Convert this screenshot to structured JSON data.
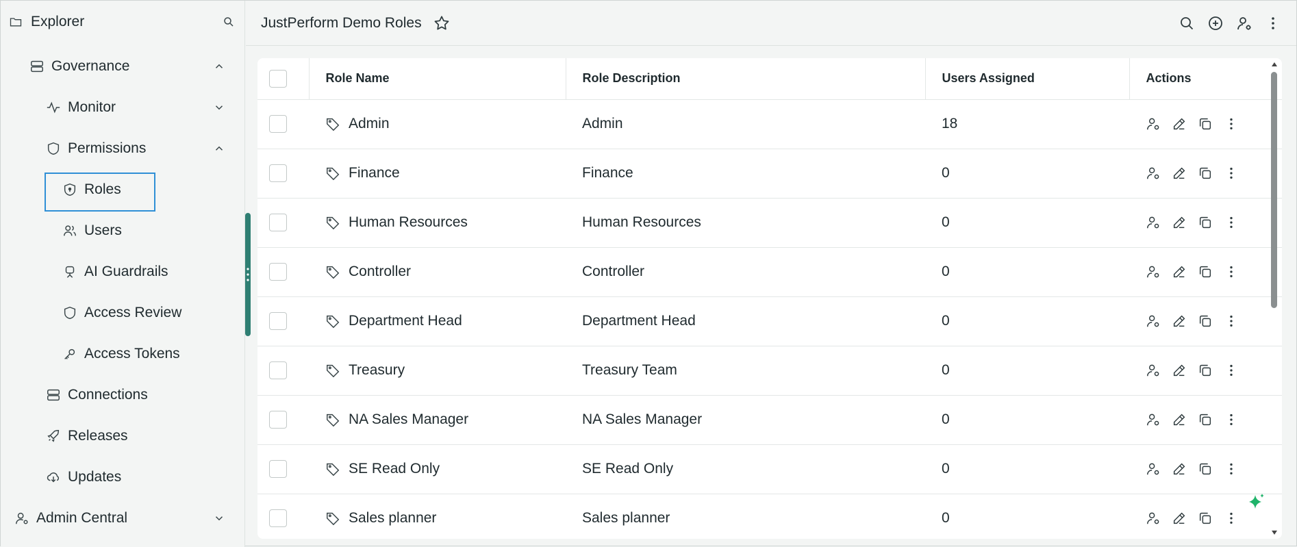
{
  "sidebar": {
    "title": "Explorer",
    "items": [
      {
        "label": "Governance"
      },
      {
        "label": "Monitor"
      },
      {
        "label": "Permissions"
      },
      {
        "label": "Roles"
      },
      {
        "label": "Users"
      },
      {
        "label": "AI Guardrails"
      },
      {
        "label": "Access Review"
      },
      {
        "label": "Access Tokens"
      },
      {
        "label": "Connections"
      },
      {
        "label": "Releases"
      },
      {
        "label": "Updates"
      },
      {
        "label": "Admin Central"
      }
    ]
  },
  "header": {
    "title": "JustPerform Demo Roles"
  },
  "table": {
    "columns": {
      "name": "Role Name",
      "description": "Role Description",
      "users": "Users Assigned",
      "actions": "Actions"
    },
    "rows": [
      {
        "name": "Admin",
        "description": "Admin",
        "users": "18"
      },
      {
        "name": "Finance",
        "description": "Finance",
        "users": "0"
      },
      {
        "name": "Human Resources",
        "description": "Human Resources",
        "users": "0"
      },
      {
        "name": "Controller",
        "description": "Controller",
        "users": "0"
      },
      {
        "name": "Department Head",
        "description": "Department Head",
        "users": "0"
      },
      {
        "name": "Treasury",
        "description": "Treasury Team",
        "users": "0"
      },
      {
        "name": "NA Sales Manager",
        "description": "NA Sales Manager",
        "users": "0"
      },
      {
        "name": "SE Read Only",
        "description": "SE Read Only",
        "users": "0"
      },
      {
        "name": "Sales planner",
        "description": "Sales planner",
        "users": "0"
      }
    ]
  },
  "colors": {
    "accent": "#2e8fd6",
    "handle": "#2f7f73",
    "sparkle": "#1fb36a"
  }
}
